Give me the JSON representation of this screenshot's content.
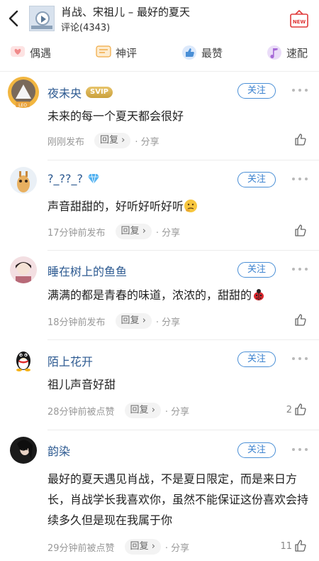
{
  "header": {
    "title": "肖战、宋祖儿 – 最好的夏天",
    "comment_count": "评论(4343)",
    "new_badge": "NEW"
  },
  "tabs": [
    {
      "label": "偶遇",
      "icon": "heart-chat-icon"
    },
    {
      "label": "神评",
      "icon": "message-icon"
    },
    {
      "label": "最赞",
      "icon": "thumbs-up-icon"
    },
    {
      "label": "速配",
      "icon": "music-note-icon"
    }
  ],
  "comments": [
    {
      "nick": "夜未央",
      "badge": "SVIP",
      "follow": "关注",
      "text": "未来的每一个夏天都会很好",
      "time": "刚刚发布",
      "reply": "回复",
      "share": "分享",
      "likes": ""
    },
    {
      "nick": "?_??_?",
      "badge": "diamond",
      "follow": "关注",
      "text": "声音甜甜的，好听好听好听",
      "time": "17分钟前发布",
      "reply": "回复",
      "share": "分享",
      "likes": ""
    },
    {
      "nick": "睡在树上的鱼鱼",
      "badge": "",
      "follow": "关注",
      "text": "满满的都是青春的味道，浓浓的，甜甜的",
      "time": "18分钟前发布",
      "reply": "回复",
      "share": "分享",
      "likes": ""
    },
    {
      "nick": "陌上花开",
      "badge": "",
      "follow": "关注",
      "text": "祖儿声音好甜",
      "time": "28分钟前被点赞",
      "reply": "回复",
      "share": "分享",
      "likes": "2"
    },
    {
      "nick": "韵染",
      "badge": "",
      "follow": "关注",
      "text": "最好的夏天遇见肖战，不是夏日限定，而是来日方长，肖战学长我喜欢你，虽然不能保证这份喜欢会持续多久但是现在我属于你",
      "time": "29分钟前被点赞",
      "reply": "回复",
      "share": "分享",
      "likes": "11"
    }
  ],
  "colors": {
    "nick": "#2d5a91",
    "follow": "#3b82cf",
    "meta": "#999999"
  }
}
